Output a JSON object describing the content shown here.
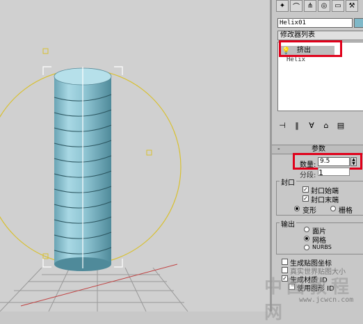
{
  "object_name": "Helix01",
  "modifier_list_label": "修改器列表",
  "stack": {
    "active_modifier": "挤出",
    "base_object": "Helix"
  },
  "rollout": {
    "title": "参数",
    "collapse_symbol": "-"
  },
  "parameters": {
    "amount_label": "数量:",
    "amount_value": "9.5",
    "segments_label": "分段:",
    "segments_value": "1"
  },
  "capping": {
    "title": "封口",
    "cap_start": "封口始端",
    "cap_end": "封口末端",
    "morph": "变形",
    "grid": "栅格"
  },
  "output": {
    "title": "输出",
    "patch": "面片",
    "mesh": "网格",
    "nurbs": "NURBS"
  },
  "options": {
    "gen_mapping": "生成贴图坐标",
    "real_world": "真实世界贴图大小",
    "gen_material": "生成材质 ID",
    "use_shape_ids": "使用图形 ID"
  },
  "watermark": {
    "text": "中国教程网",
    "url": "www.jcwcn.com"
  },
  "colors": {
    "highlight_box": "#e0001a",
    "object_color": "#7fb8c8",
    "gizmo_yellow": "#d8c030"
  }
}
